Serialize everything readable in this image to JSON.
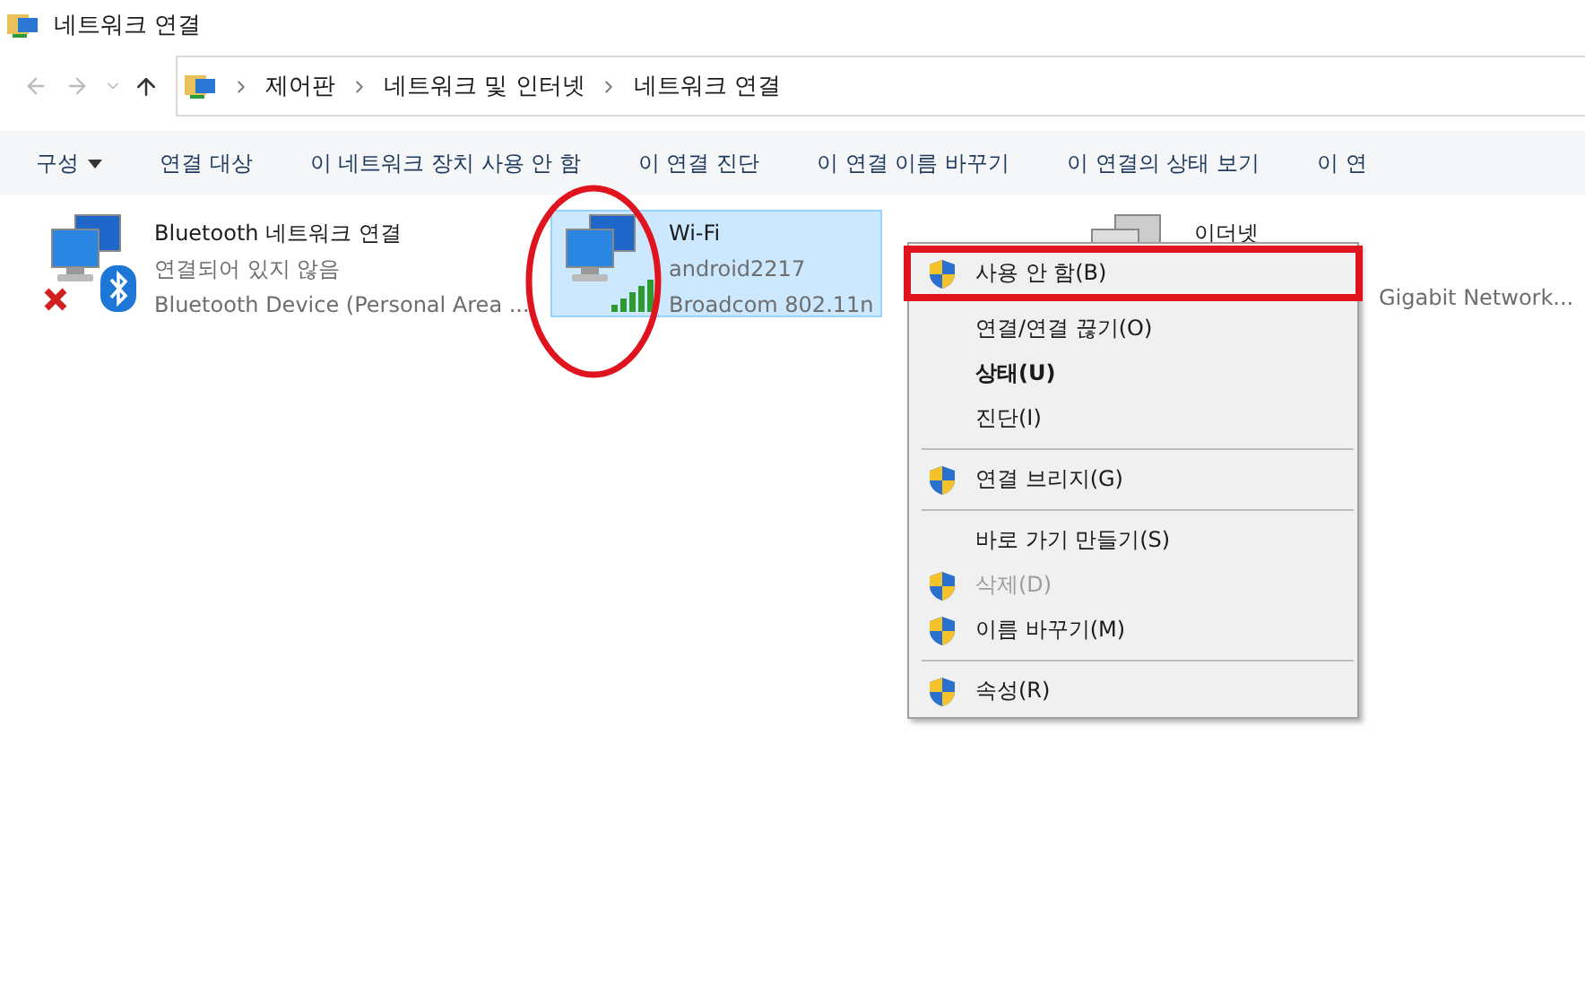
{
  "window": {
    "title": "네트워크 연결"
  },
  "breadcrumb": [
    "제어판",
    "네트워크 및 인터넷",
    "네트워크 연결"
  ],
  "toolbar": [
    {
      "label": "구성",
      "dropdown": true
    },
    {
      "label": "연결 대상",
      "dropdown": false
    },
    {
      "label": "이 네트워크 장치 사용 안 함",
      "dropdown": false
    },
    {
      "label": "이 연결 진단",
      "dropdown": false
    },
    {
      "label": "이 연결 이름 바꾸기",
      "dropdown": false
    },
    {
      "label": "이 연결의 상태 보기",
      "dropdown": false
    },
    {
      "label": "이 연",
      "dropdown": false
    }
  ],
  "connections": [
    {
      "kind": "bluetooth",
      "name": "Bluetooth 네트워크 연결",
      "status": "연결되어 있지 않음",
      "device": "Bluetooth Device (Personal Area ...",
      "selected": false,
      "annotated": false
    },
    {
      "kind": "wifi",
      "name": "Wi-Fi",
      "status": "android2217",
      "device": "Broadcom 802.11n",
      "selected": true,
      "annotated": true
    },
    {
      "kind": "ethernet",
      "name": "이더넷",
      "device": "Gigabit Network...",
      "selected": false,
      "annotated": false
    }
  ],
  "context_menu": [
    [
      {
        "label": "사용 안 함(B)",
        "shield": true,
        "bold": false,
        "disabled": false,
        "annotated": true
      },
      {
        "label": "연결/연결 끊기(O)",
        "shield": false,
        "bold": false,
        "disabled": false,
        "annotated": false
      },
      {
        "label": "상태(U)",
        "shield": false,
        "bold": true,
        "disabled": false,
        "annotated": false
      },
      {
        "label": "진단(I)",
        "shield": false,
        "bold": false,
        "disabled": false,
        "annotated": false
      }
    ],
    [
      {
        "label": "연결 브리지(G)",
        "shield": true,
        "bold": false,
        "disabled": false,
        "annotated": false
      }
    ],
    [
      {
        "label": "바로 가기 만들기(S)",
        "shield": false,
        "bold": false,
        "disabled": false,
        "annotated": false
      },
      {
        "label": "삭제(D)",
        "shield": true,
        "bold": false,
        "disabled": true,
        "annotated": false
      },
      {
        "label": "이름 바꾸기(M)",
        "shield": true,
        "bold": false,
        "disabled": false,
        "annotated": false
      }
    ],
    [
      {
        "label": "속성(R)",
        "shield": true,
        "bold": false,
        "disabled": false,
        "annotated": false
      }
    ]
  ]
}
